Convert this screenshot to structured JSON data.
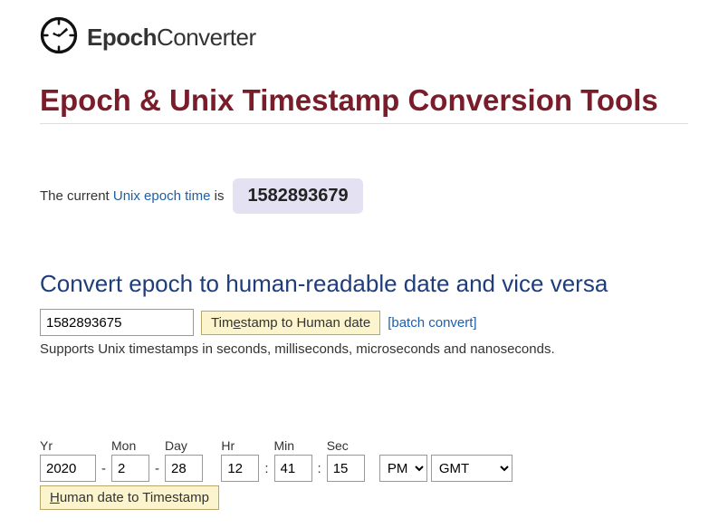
{
  "logo": {
    "bold": "Epoch",
    "light": "Converter"
  },
  "page_title": "Epoch & Unix Timestamp Conversion Tools",
  "current": {
    "prefix": "The current ",
    "link": "Unix epoch time",
    "suffix": " is",
    "value": "1582893679"
  },
  "section1": {
    "title": "Convert epoch to human-readable date and vice versa",
    "ts_input": "1582893675",
    "button_pre": "Tim",
    "button_ul": "e",
    "button_post": "stamp to Human date",
    "batch": "[batch convert]",
    "hint": "Supports Unix timestamps in seconds, milliseconds, microseconds and nanoseconds."
  },
  "section2": {
    "labels": {
      "yr": "Yr",
      "mon": "Mon",
      "day": "Day",
      "hr": "Hr",
      "min": "Min",
      "sec": "Sec"
    },
    "values": {
      "yr": "2020",
      "mon": "2",
      "day": "28",
      "hr": "12",
      "min": "41",
      "sec": "15",
      "ampm": "PM",
      "tz": "GMT"
    },
    "button_ul": "H",
    "button_post": "uman date to Timestamp"
  }
}
